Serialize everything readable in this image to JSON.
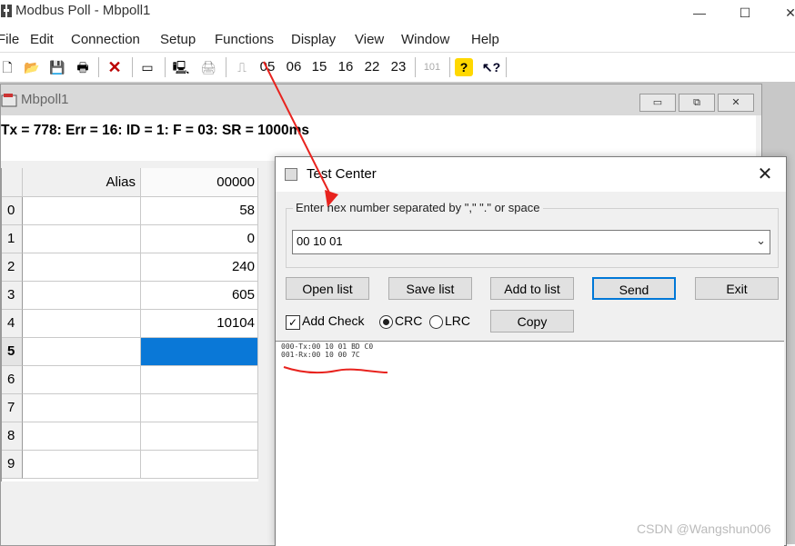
{
  "app": {
    "title": "Modbus Poll - Mbpoll1"
  },
  "menu": [
    "File",
    "Edit",
    "Connection",
    "Setup",
    "Functions",
    "Display",
    "View",
    "Window",
    "Help"
  ],
  "toolbar": {
    "func_codes": [
      "05",
      "06",
      "15",
      "16",
      "22",
      "23"
    ],
    "disabled_code": "101"
  },
  "child": {
    "title": "Mbpoll1",
    "status": "Tx = 778: Err = 16: ID = 1: F = 03: SR = 1000ms",
    "grid": {
      "col_alias": "Alias",
      "col_addr": "00000",
      "rows": [
        {
          "index": "0",
          "alias": "",
          "value": "58"
        },
        {
          "index": "1",
          "alias": "",
          "value": "0"
        },
        {
          "index": "2",
          "alias": "",
          "value": "240"
        },
        {
          "index": "3",
          "alias": "",
          "value": "605"
        },
        {
          "index": "4",
          "alias": "",
          "value": "10104"
        },
        {
          "index": "5",
          "alias": "",
          "value": ""
        },
        {
          "index": "6",
          "alias": "",
          "value": ""
        },
        {
          "index": "7",
          "alias": "",
          "value": ""
        },
        {
          "index": "8",
          "alias": "",
          "value": ""
        },
        {
          "index": "9",
          "alias": "",
          "value": ""
        }
      ]
    }
  },
  "dialog": {
    "title": "Test Center",
    "group_label": "Enter hex number separated by \",\" \".\" or space",
    "hex_value": "00 10 01",
    "buttons": {
      "open": "Open list",
      "save": "Save list",
      "add": "Add to list",
      "send": "Send",
      "exit": "Exit",
      "copy": "Copy"
    },
    "add_check_label": "Add Check",
    "crc_label": "CRC",
    "lrc_label": "LRC",
    "log": [
      "000-Tx:00 10 01 BD C0",
      "001-Rx:00 10 00 7C"
    ]
  },
  "watermark": "CSDN @Wangshun006",
  "colors": {
    "selection": "#0a78d7",
    "annotation": "#e8231e",
    "send_border": "#0078d7"
  }
}
